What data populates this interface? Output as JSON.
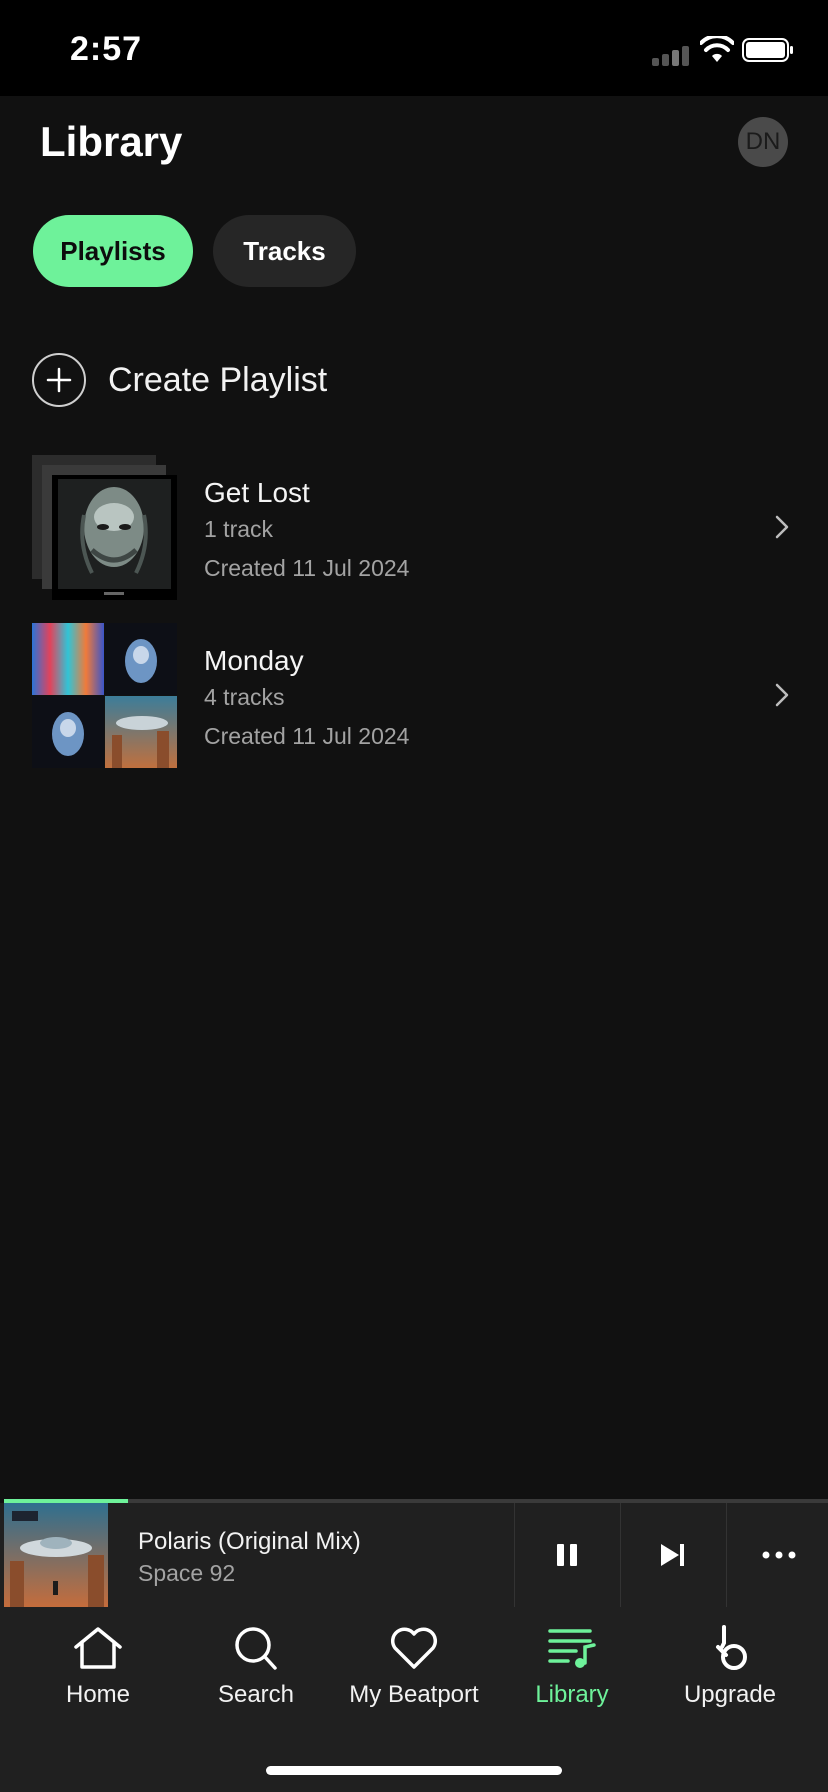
{
  "status_bar": {
    "time": "2:57"
  },
  "header": {
    "title": "Library",
    "avatar_initials": "DN"
  },
  "tabs": [
    {
      "label": "Playlists",
      "active": true
    },
    {
      "label": "Tracks",
      "active": false
    }
  ],
  "create_playlist": {
    "label": "Create Playlist",
    "icon": "plus-icon"
  },
  "playlists": [
    {
      "name": "Get Lost",
      "tracks": "1 track",
      "created": "Created 11 Jul 2024"
    },
    {
      "name": "Monday",
      "tracks": "4 tracks",
      "created": "Created 11 Jul 2024"
    }
  ],
  "now_playing": {
    "title": "Polaris (Original Mix)",
    "artist": "Space 92",
    "progress": 0.15,
    "controls": [
      "pause-icon",
      "skip-next-icon",
      "more-icon"
    ]
  },
  "bottom_nav": [
    {
      "label": "Home",
      "icon": "home-icon",
      "active": false
    },
    {
      "label": "Search",
      "icon": "search-icon",
      "active": false
    },
    {
      "label": "My Beatport",
      "icon": "heart-icon",
      "active": false
    },
    {
      "label": "Library",
      "icon": "library-icon",
      "active": true
    },
    {
      "label": "Upgrade",
      "icon": "beatport-logo-icon",
      "active": false
    }
  ],
  "colors": {
    "accent": "#6ef29a",
    "background": "#111111",
    "surface": "#202020"
  }
}
